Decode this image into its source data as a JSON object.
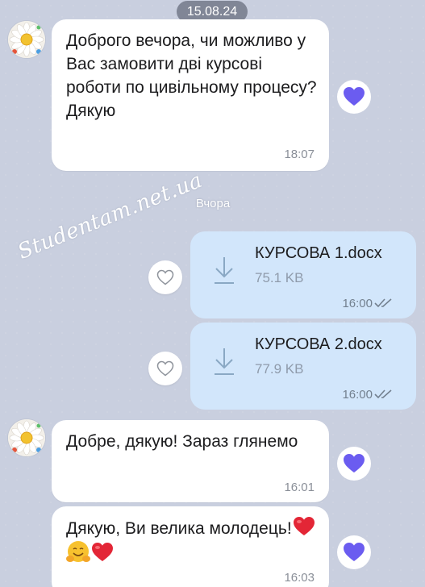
{
  "chat": {
    "date_pill": "15.08.24",
    "day_separator": "Вчора",
    "watermark": "Studentam.net.ua",
    "colors": {
      "background": "#c9cfdf",
      "incoming_bubble": "#ffffff",
      "outgoing_bubble": "#d2e6fb",
      "reaction_heart": "#6b5cf0"
    },
    "messages": [
      {
        "text": "Доброго вечора, чи можливо у Вас замовити дві курсові роботи по цивільному процесу? Дякую",
        "time": "18:07",
        "reaction": "heart-icon"
      },
      {
        "file_name": "КУРСОВА 1.docx",
        "file_size": "75.1 KB",
        "time": "16:00",
        "reaction": "like-outline-icon"
      },
      {
        "file_name": "КУРСОВА 2.docx",
        "file_size": "77.9 KB",
        "time": "16:00",
        "reaction": "like-outline-icon"
      },
      {
        "text": "Добре, дякую! Зараз глянемо",
        "time": "16:01",
        "reaction": "heart-icon"
      },
      {
        "text": "Дякую, Ви велика молодець!",
        "emojis": "❤️🤗❤️",
        "time": "16:03",
        "reaction": "heart-icon"
      }
    ]
  }
}
